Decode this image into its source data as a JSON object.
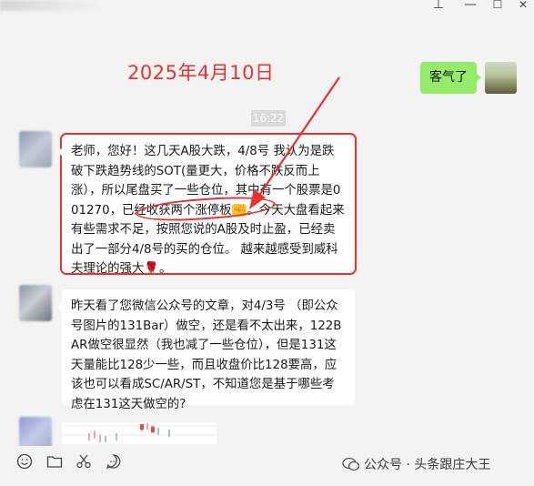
{
  "window": {
    "min_glyph": "—",
    "max_glyph": "☐",
    "close_glyph": "✕",
    "pin_glyph": "⊥"
  },
  "annotation": {
    "date": "2025年4月10日",
    "accent": "#e8322d"
  },
  "chat": {
    "outgoing": {
      "text": "客气了",
      "color": "#95ec69"
    },
    "timestamp": "16:22",
    "message1": {
      "part1": "老师，您好！这几天A股大跌，4/8号 我认为是跌破下跌趋势线的SOT(量更大，价格不跌反而上涨），所以尾盘买了一些仓位，其中有一个股票是001270，",
      "highlight": "已经收获两个涨停板",
      "highlight_emoji": "✊",
      "part2": "。今天大盘看起来有些需求不足，按照您说的A股及时止盈，已经卖出了一部分4/8号的买的仓位。 越来越感受到威科夫理论的强大",
      "rose": "🌹",
      "end": "。"
    },
    "message2": "昨天看了您微信公众号的文章，对4/3号 （即公众号图片的131Bar）做空，还是看不太出来，122BAR做空很显然（我也减了一些仓位），但是131这天量能比128少一些，而且收盘价比128要高，应该也可以看成SC/AR/ST，不知道您是基于哪些考虑在131这天做空的?"
  },
  "toolbar": {
    "icons": [
      "emoji-icon",
      "folder-icon",
      "scissors-icon",
      "chat-history-icon"
    ]
  },
  "watermark": {
    "text": "公众号 · 头条跟庄大王"
  }
}
